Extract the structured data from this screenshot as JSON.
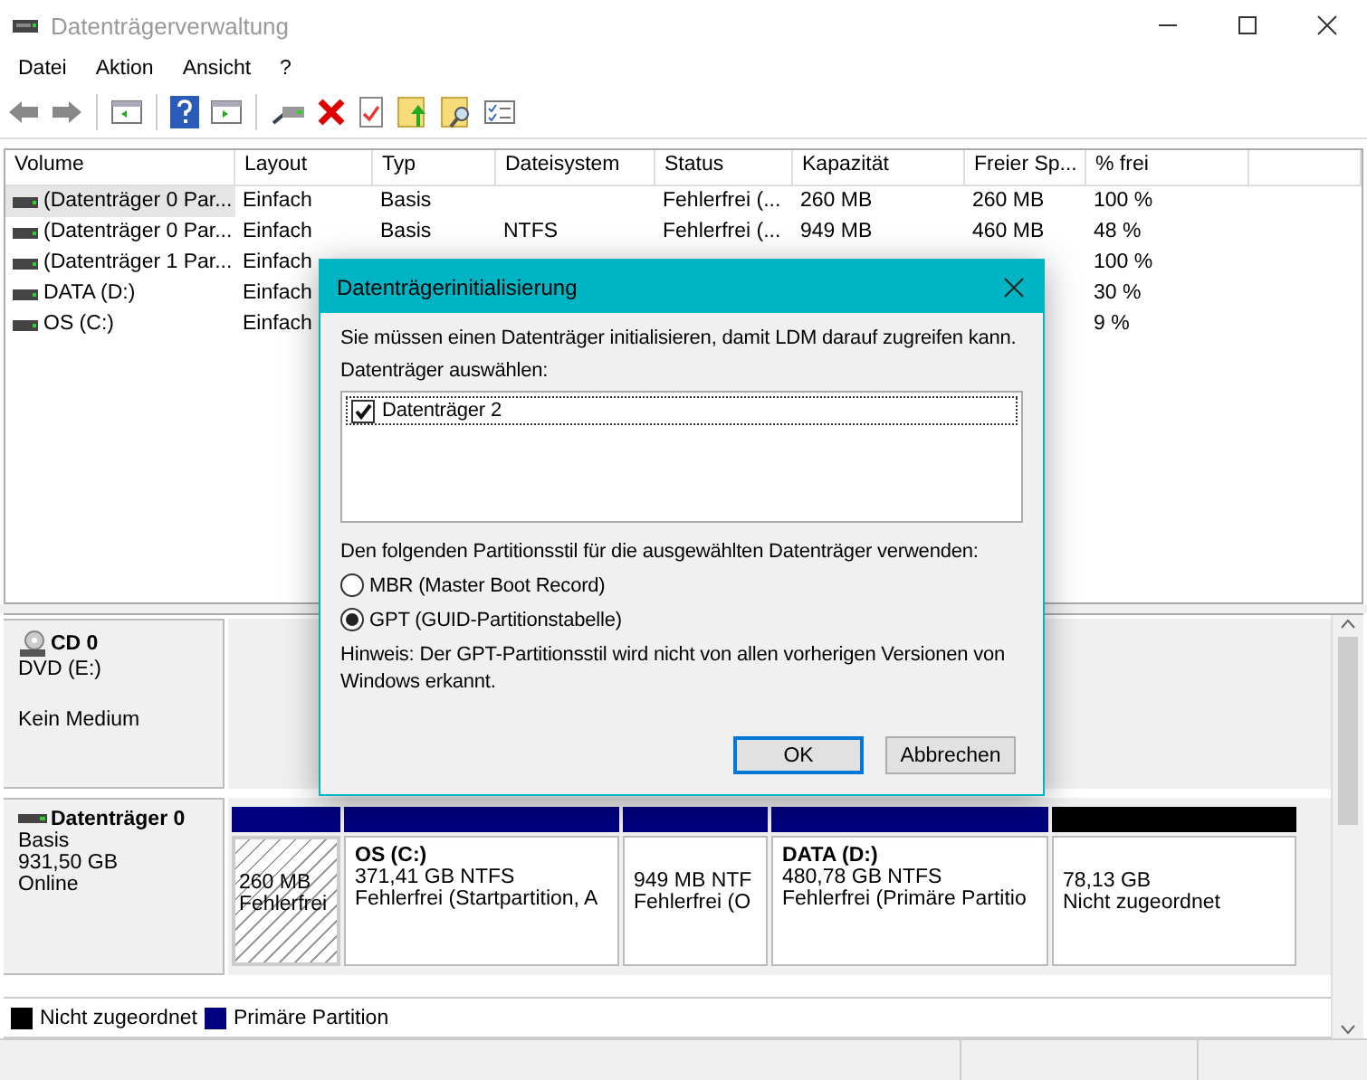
{
  "window": {
    "title": "Datenträgerverwaltung"
  },
  "menu": [
    "Datei",
    "Aktion",
    "Ansicht",
    "?"
  ],
  "volume_table": {
    "columns": [
      "Volume",
      "Layout",
      "Typ",
      "Dateisystem",
      "Status",
      "Kapazität",
      "Freier Sp...",
      "% frei"
    ],
    "rows": [
      {
        "selected": true,
        "cells": [
          "(Datenträger 0 Par...",
          "Einfach",
          "Basis",
          null,
          "Fehlerfrei (...",
          "260 MB",
          "260 MB",
          "100 %"
        ]
      },
      {
        "selected": false,
        "cells": [
          "(Datenträger 0 Par...",
          "Einfach",
          "Basis",
          "NTFS",
          "Fehlerfrei (...",
          "949 MB",
          "460 MB",
          "48 %"
        ]
      },
      {
        "selected": false,
        "cells": [
          "(Datenträger 1 Par...",
          "Einfach",
          null,
          null,
          null,
          null,
          null,
          "100 %"
        ]
      },
      {
        "selected": false,
        "cells": [
          "DATA (D:)",
          "Einfach",
          null,
          null,
          null,
          null,
          null,
          "30 %"
        ]
      },
      {
        "selected": false,
        "cells": [
          "OS (C:)",
          "Einfach",
          null,
          null,
          null,
          null,
          null,
          "9 %"
        ]
      }
    ]
  },
  "disks": [
    {
      "kind": "cdrom",
      "name": "CD 0",
      "lines": [
        "DVD (E:)",
        "Kein Medium"
      ]
    },
    {
      "kind": "disk",
      "name": "Datenträger 0",
      "lines": [
        "Basis",
        "931,50 GB",
        "Online"
      ],
      "partitions": [
        {
          "kind": "primary",
          "selected": true,
          "lines": [
            "260 MB",
            "Fehlerfrei"
          ]
        },
        {
          "kind": "primary",
          "selected": false,
          "title": "OS  (C:)",
          "lines": [
            "371,41 GB NTFS",
            "Fehlerfrei (Startpartition, A"
          ]
        },
        {
          "kind": "primary",
          "selected": false,
          "lines": [
            "949 MB NTF",
            "Fehlerfrei (O"
          ]
        },
        {
          "kind": "primary",
          "selected": false,
          "title": "DATA  (D:)",
          "lines": [
            "480,78 GB NTFS",
            "Fehlerfrei (Primäre Partitio"
          ]
        },
        {
          "kind": "unallocated",
          "selected": false,
          "lines": [
            "78,13 GB",
            "Nicht zugeordnet"
          ]
        }
      ]
    }
  ],
  "legend": [
    {
      "label": "Nicht zugeordnet",
      "color": "#000000"
    },
    {
      "label": "Primäre Partition",
      "color": "#000080"
    }
  ],
  "dialog": {
    "title": "Datenträgerinitialisierung",
    "message": "Sie müssen einen Datenträger initialisieren, damit LDM darauf zugreifen kann.",
    "list_label": "Datenträger auswählen:",
    "disks": [
      {
        "label": "Datenträger 2",
        "checked": true
      }
    ],
    "style_label": "Den folgenden Partitionsstil für die ausgewählten Datenträger verwenden:",
    "styles": [
      {
        "label": "MBR (Master Boot Record)",
        "selected": false
      },
      {
        "label": "GPT (GUID-Partitionstabelle)",
        "selected": true
      }
    ],
    "hint": "Hinweis: Der GPT-Partitionsstil wird nicht von allen vorherigen Versionen von Windows erkannt.",
    "buttons": [
      {
        "label": "OK",
        "default": true
      },
      {
        "label": "Abbrechen",
        "default": false
      }
    ]
  }
}
